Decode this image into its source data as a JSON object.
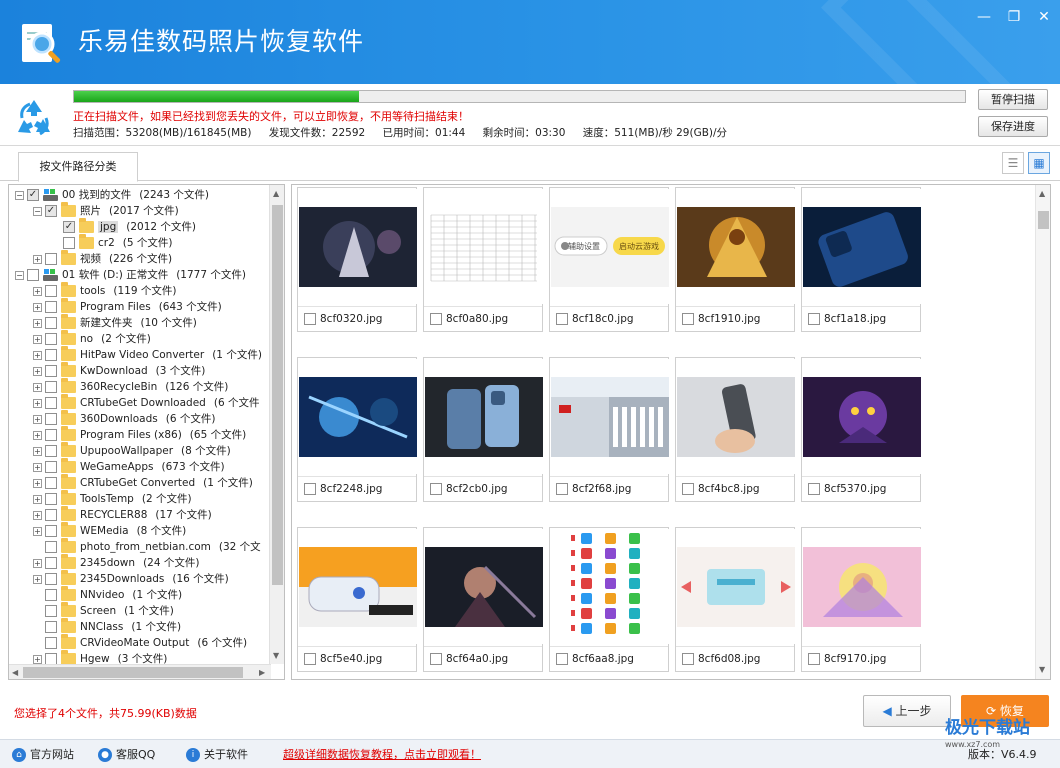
{
  "app": {
    "title": "乐易佳数码照片恢复软件"
  },
  "scan": {
    "progress_fraction": 0.32,
    "message": "正在扫描文件，如果已经找到您丢失的文件，可以立即恢复，不用等待扫描结束！",
    "range": "扫描范围：53208(MB)/161845(MB)",
    "found": "发现文件数：22592",
    "elapsed": "已用时间：01:44",
    "remaining": "剩余时间：03:30",
    "speed": "速度：511(MB)/秒  29(GB)/分",
    "pause_label": "暂停扫描",
    "save_label": "保存进度"
  },
  "tab": {
    "label": "按文件路径分类"
  },
  "tree": [
    {
      "label": "00 找到的文件",
      "count": "(2243 个文件)",
      "icon": "drive"
    },
    {
      "label": "照片",
      "count": "(2017 个文件)",
      "icon": "folder"
    },
    {
      "label": "jpg",
      "count": "(2012 个文件)",
      "icon": "folder"
    },
    {
      "label": "cr2",
      "count": "(5 个文件)",
      "icon": "folder"
    },
    {
      "label": "视频",
      "count": "(226 个文件)",
      "icon": "folder"
    },
    {
      "label": "01 软件 (D:) 正常文件",
      "count": "(1777 个文件)",
      "icon": "drive"
    },
    {
      "label": "tools",
      "count": "(119 个文件)",
      "icon": "folder"
    },
    {
      "label": "Program Files",
      "count": "(643 个文件)",
      "icon": "folder"
    },
    {
      "label": "新建文件夹",
      "count": "(10 个文件)",
      "icon": "folder"
    },
    {
      "label": "no",
      "count": "(2 个文件)",
      "icon": "folder"
    },
    {
      "label": "HitPaw Video Converter",
      "count": "(1 个文件)",
      "icon": "folder"
    },
    {
      "label": "KwDownload",
      "count": "(3 个文件)",
      "icon": "folder"
    },
    {
      "label": "360RecycleBin",
      "count": "(126 个文件)",
      "icon": "folder"
    },
    {
      "label": "CRTubeGet Downloaded",
      "count": "(6 个文件",
      "icon": "folder"
    },
    {
      "label": "360Downloads",
      "count": "(6 个文件)",
      "icon": "folder"
    },
    {
      "label": "Program Files (x86)",
      "count": "(65 个文件)",
      "icon": "folder"
    },
    {
      "label": "UpupooWallpaper",
      "count": "(8 个文件)",
      "icon": "folder"
    },
    {
      "label": "WeGameApps",
      "count": "(673 个文件)",
      "icon": "folder"
    },
    {
      "label": "CRTubeGet Converted",
      "count": "(1 个文件)",
      "icon": "folder"
    },
    {
      "label": "ToolsTemp",
      "count": "(2 个文件)",
      "icon": "folder"
    },
    {
      "label": "RECYCLER88",
      "count": "(17 个文件)",
      "icon": "folder"
    },
    {
      "label": "WEMedia",
      "count": "(8 个文件)",
      "icon": "folder"
    },
    {
      "label": "photo_from_netbian.com",
      "count": "(32 个文",
      "icon": "folder"
    },
    {
      "label": "2345down",
      "count": "(24 个文件)",
      "icon": "folder"
    },
    {
      "label": "2345Downloads",
      "count": "(16 个文件)",
      "icon": "folder"
    },
    {
      "label": "NNvideo",
      "count": "(1 个文件)",
      "icon": "folder"
    },
    {
      "label": "Screen",
      "count": "(1 个文件)",
      "icon": "folder"
    },
    {
      "label": "NNClass",
      "count": "(1 个文件)",
      "icon": "folder"
    },
    {
      "label": "CRVideoMate Output",
      "count": "(6 个文件)",
      "icon": "folder"
    },
    {
      "label": "Hgew",
      "count": "(3 个文件)",
      "icon": "folder"
    }
  ],
  "thumbs": [
    {
      "name": "8cf0320.jpg",
      "kind": "dark-warrior"
    },
    {
      "name": "8cf0a80.jpg",
      "kind": "spreadsheet"
    },
    {
      "name": "8cf18c0.jpg",
      "kind": "buttons"
    },
    {
      "name": "8cf1910.jpg",
      "kind": "gold-warrior"
    },
    {
      "name": "8cf1a18.jpg",
      "kind": "blue-phone"
    },
    {
      "name": "8cf2248.jpg",
      "kind": "blue-archer"
    },
    {
      "name": "8cf2cb0.jpg",
      "kind": "phones"
    },
    {
      "name": "8cf2f68.jpg",
      "kind": "building"
    },
    {
      "name": "8cf4bc8.jpg",
      "kind": "hand-phone"
    },
    {
      "name": "8cf5370.jpg",
      "kind": "purple-char"
    },
    {
      "name": "8cf5e40.jpg",
      "kind": "device"
    },
    {
      "name": "8cf64a0.jpg",
      "kind": "dark-girl"
    },
    {
      "name": "8cf6aa8.jpg",
      "kind": "icons"
    },
    {
      "name": "8cf6d08.jpg",
      "kind": "card"
    },
    {
      "name": "8cf9170.jpg",
      "kind": "bright-char"
    }
  ],
  "thumb_button_labels": {
    "assist": "辅助设置",
    "launch": "启动云游戏"
  },
  "footer": {
    "selection_info": "您选择了4个文件，共75.99(KB)数据",
    "prev_label": "上一步",
    "recover_label": "恢复"
  },
  "statusbar": {
    "website": "官方网站",
    "support": "客服QQ",
    "about": "关于软件",
    "promo": "超级详细数据恢复教程，点击立即观看！",
    "version": "版本：V6.4.9"
  },
  "watermark": {
    "text": "极光下载站",
    "sub": "www.xz7.com"
  },
  "colors": {
    "title_bg": "#1b82dc",
    "progress": "#2db52d",
    "alert_red": "#e00000",
    "recover_orange": "#f5841f"
  }
}
